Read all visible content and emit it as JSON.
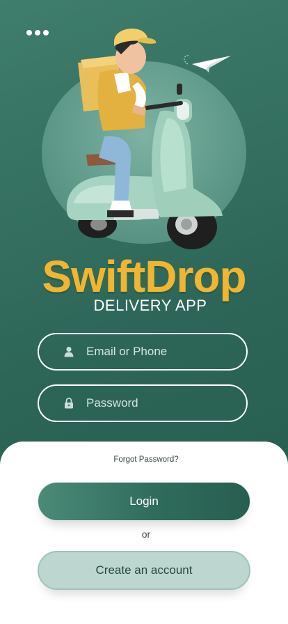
{
  "app": {
    "brand": "SwiftDrop",
    "tagline": "DELIVERY APP"
  },
  "menu": {
    "icon": "more-dots-icon"
  },
  "hero": {
    "illustration": "delivery-scooter-rider",
    "accent_icon": "paper-plane-icon"
  },
  "form": {
    "email": {
      "placeholder": "Email or Phone",
      "value": "",
      "icon": "user-icon"
    },
    "password": {
      "placeholder": "Password",
      "value": "",
      "icon": "lock-icon"
    }
  },
  "actions": {
    "forgot_password": "Forgot Password?",
    "login": "Login",
    "separator": "or",
    "create_account": "Create an account"
  },
  "colors": {
    "background": "#2f6a5c",
    "brand_yellow": "#f2b52f",
    "sheet": "#ffffff",
    "login_button": "#2f6c5c",
    "create_button": "#bdd6d0"
  }
}
